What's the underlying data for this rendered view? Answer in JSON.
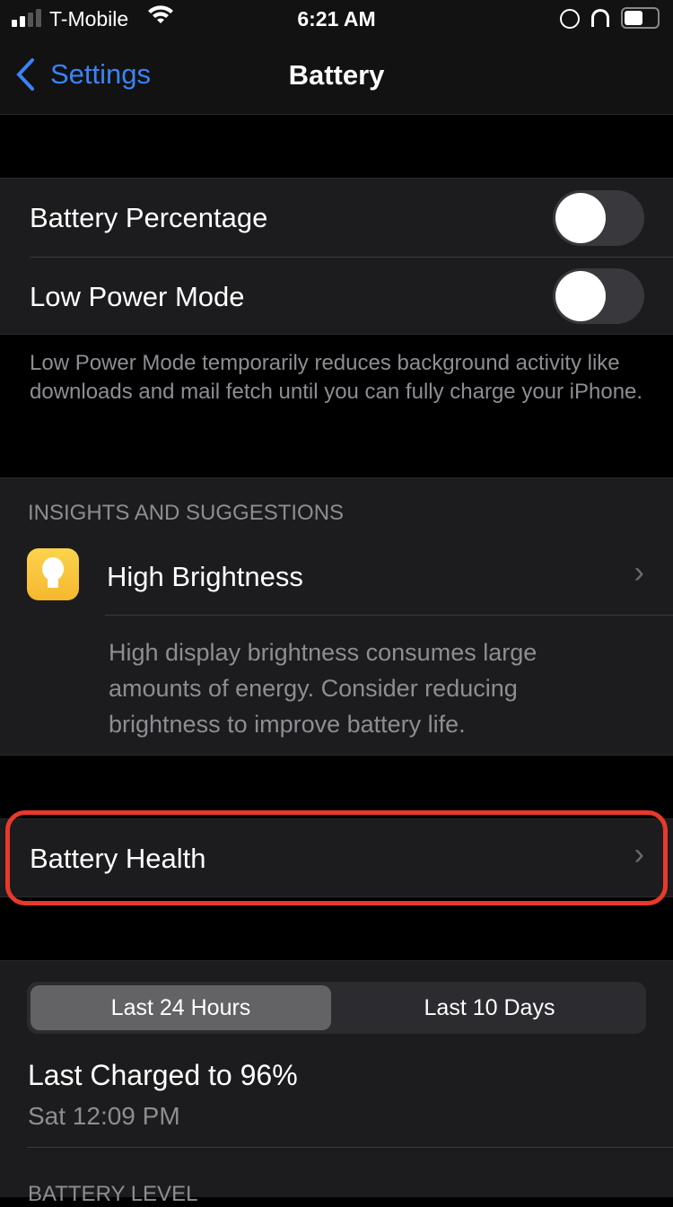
{
  "status_bar": {
    "carrier": "T-Mobile",
    "time": "6:21 AM"
  },
  "nav": {
    "back_label": "Settings",
    "title": "Battery"
  },
  "toggles": [
    {
      "label": "Battery Percentage",
      "on": false
    },
    {
      "label": "Low Power Mode",
      "on": false
    }
  ],
  "low_power_footer": "Low Power Mode temporarily reduces background activity like downloads and mail fetch until you can fully charge your iPhone.",
  "insights": {
    "header": "INSIGHTS AND SUGGESTIONS",
    "item": {
      "title": "High Brightness",
      "icon": "lightbulb-icon",
      "description": "High display brightness consumes large amounts of energy. Consider reducing brightness to improve battery life."
    }
  },
  "battery_health": {
    "label": "Battery Health",
    "highlight_color": "#e8392a"
  },
  "usage": {
    "segments": [
      "Last 24 Hours",
      "Last 10 Days"
    ],
    "selected": 0,
    "last_charged": "Last Charged to 96%",
    "last_charged_time": "Sat 12:09 PM",
    "battery_level_header": "BATTERY LEVEL"
  },
  "colors": {
    "accent": "#3b82f6",
    "cell": "#1c1c1e"
  }
}
